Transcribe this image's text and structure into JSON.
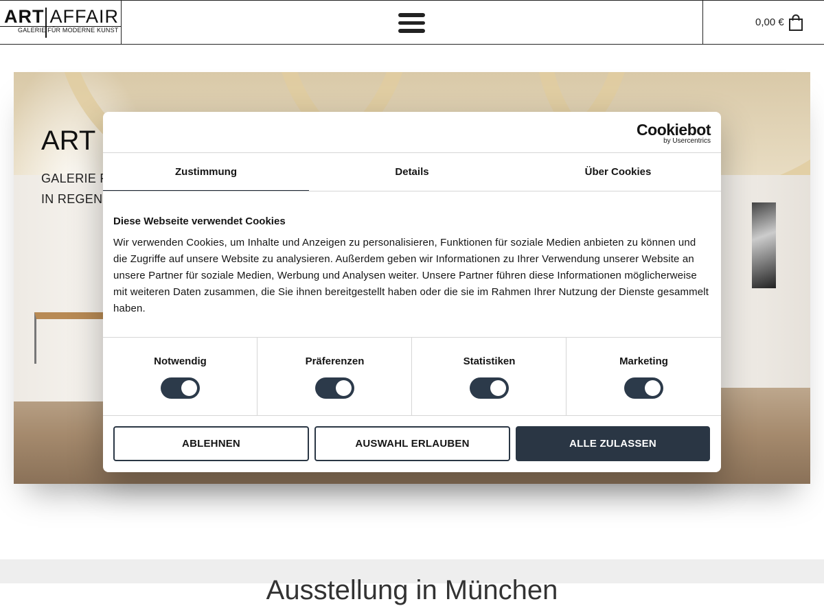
{
  "header": {
    "logo": {
      "word1": "ART",
      "word2": "AFFAIR",
      "tagline": "GALERIE FÜR MODERNE KUNST"
    },
    "menu_icon": "hamburger-menu-icon",
    "cart": {
      "amount": "0,00 €",
      "icon": "shopping-bag-icon"
    }
  },
  "hero": {
    "title": "ART",
    "subtitle_line1": "GALERIE F",
    "subtitle_line2": "IN REGENS"
  },
  "below_fold": {
    "heading": "Ausstellung in München"
  },
  "cookie_dialog": {
    "brand": {
      "name": "Cookiebot",
      "by": "by Usercentrics"
    },
    "tabs": [
      {
        "label": "Zustimmung",
        "active": true
      },
      {
        "label": "Details",
        "active": false
      },
      {
        "label": "Über Cookies",
        "active": false
      }
    ],
    "heading": "Diese Webseite verwendet Cookies",
    "text": "Wir verwenden Cookies, um Inhalte und Anzeigen zu personalisieren, Funktionen für soziale Medien anbieten zu können und die Zugriffe auf unsere Website zu analysieren. Außerdem geben wir Informationen zu Ihrer Verwendung unserer Website an unsere Partner für soziale Medien, Werbung und Analysen weiter. Unsere Partner führen diese Informationen möglicherweise mit weiteren Daten zusammen, die Sie ihnen bereitgestellt haben oder die sie im Rahmen Ihrer Nutzung der Dienste gesammelt haben.",
    "categories": [
      {
        "label": "Notwendig",
        "enabled": true
      },
      {
        "label": "Präferenzen",
        "enabled": true
      },
      {
        "label": "Statistiken",
        "enabled": true
      },
      {
        "label": "Marketing",
        "enabled": true
      }
    ],
    "buttons": {
      "decline": "ABLEHNEN",
      "allow_selection": "AUSWAHL ERLAUBEN",
      "allow_all": "ALLE ZULASSEN"
    },
    "colors": {
      "primary": "#2a3644",
      "toggle_on": "#2c3a4a"
    }
  }
}
